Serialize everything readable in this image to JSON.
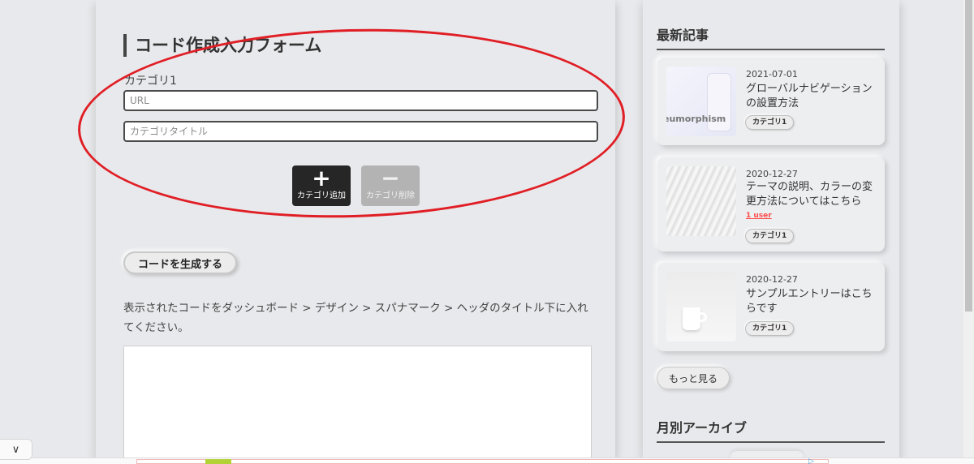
{
  "form": {
    "title": "コード作成入力フォーム",
    "category_label": "カテゴリ1",
    "url_placeholder": "URL",
    "category_title_placeholder": "カテゴリタイトル",
    "add_button": {
      "glyph": "+",
      "label": "カテゴリ追加"
    },
    "delete_button": {
      "glyph": "−",
      "label": "カテゴリ削除"
    }
  },
  "generate": {
    "button_label": "コードを生成する",
    "instructions": "表示されたコードをダッシュボード > デザイン >  スパナマーク > ヘッダのタイトル下に入れてください。"
  },
  "sidebar": {
    "latest_heading": "最新記事",
    "articles": [
      {
        "date": "2021-07-01",
        "title": "グローバルナビゲーションの設置方法",
        "tag": "カテゴリ1",
        "thumb_text": "eumorphism"
      },
      {
        "date": "2020-12-27",
        "title": "テーマの説明、カラーの変更方法についてはこちら",
        "tag": "カテゴリ1",
        "users": "1 user"
      },
      {
        "date": "2020-12-27",
        "title": "サンプルエントリーはこちらです",
        "tag": "カテゴリ1"
      }
    ],
    "more_label": "もっと見る",
    "archive_heading": "月別アーカイブ"
  },
  "icons": {
    "collapse": "chevron-down-icon",
    "collapse_glyph": "∨",
    "ad_choices_glyph": "▷"
  },
  "colors": {
    "annotation_oval": "#e01e25",
    "add_button_bg": "#262626",
    "delete_button_bg": "#b3b3b3",
    "user_badge": "#ff4a4a"
  }
}
